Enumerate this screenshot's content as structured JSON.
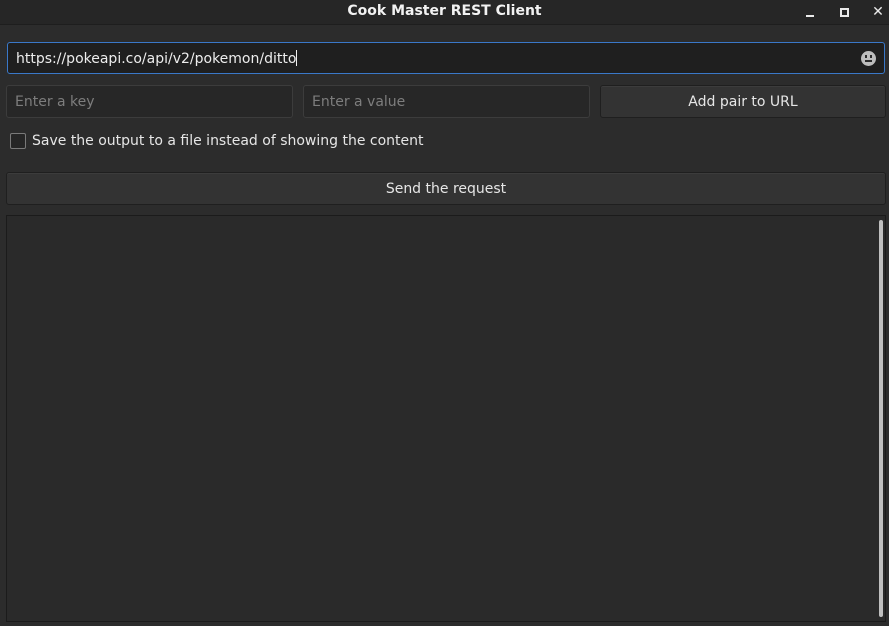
{
  "window": {
    "title": "Cook Master REST Client",
    "controls": {
      "minimize": "minimize",
      "maximize": "maximize",
      "close": "✕"
    }
  },
  "request": {
    "url_value": "https://pokeapi.co/api/v2/pokemon/ditto",
    "key_placeholder": "Enter a key",
    "value_placeholder": "Enter a value",
    "add_pair_label": "Add pair to URL",
    "save_to_file_label": "Save the output to a file instead of showing the content",
    "save_to_file_checked": false,
    "send_label": "Send the request"
  },
  "output": {
    "content": ""
  },
  "icons": {
    "emoji": "emoji-icon",
    "minimize": "minimize-icon",
    "maximize": "maximize-icon",
    "close": "close-icon"
  },
  "colors": {
    "accent": "#3a78c8",
    "background": "#2c2c2c"
  }
}
